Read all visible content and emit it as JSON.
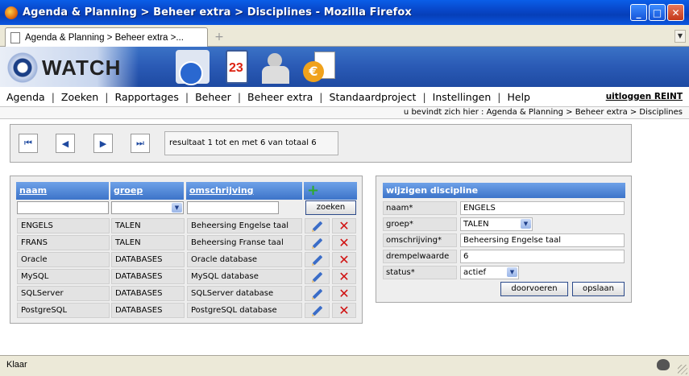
{
  "window": {
    "title": "Agenda & Planning > Beheer extra > Disciplines - Mozilla Firefox",
    "minimize": "_",
    "maximize": "□",
    "close": "✕"
  },
  "tabs": [
    {
      "label": "Agenda & Planning > Beheer extra >..."
    }
  ],
  "newtab": "+",
  "logo": {
    "text": "WATCH"
  },
  "calendar_day": "23",
  "euro": "€",
  "menu": {
    "items": [
      "Agenda",
      "Zoeken",
      "Rapportages",
      "Beheer",
      "Beheer extra",
      "Standaardproject",
      "Instellingen",
      "Help"
    ],
    "separator": "|",
    "logout": "uitloggen REINT"
  },
  "breadcrumb": "u bevindt zich hier : Agenda & Planning > Beheer extra > Disciplines",
  "pager": {
    "first": "⏮",
    "prev": "◀",
    "next": "▶",
    "last": "⏭",
    "info": "resultaat 1 tot en met 6 van totaal 6"
  },
  "table": {
    "headers": {
      "naam": "naam",
      "groep": "groep",
      "omschrijving": "omschrijving"
    },
    "add": "+",
    "search_button": "zoeken",
    "rows": [
      {
        "naam": "ENGELS",
        "groep": "TALEN",
        "omschrijving": "Beheersing Engelse taal"
      },
      {
        "naam": "FRANS",
        "groep": "TALEN",
        "omschrijving": "Beheersing Franse taal"
      },
      {
        "naam": "Oracle",
        "groep": "DATABASES",
        "omschrijving": "Oracle database"
      },
      {
        "naam": "MySQL",
        "groep": "DATABASES",
        "omschrijving": "MySQL database"
      },
      {
        "naam": "SQLServer",
        "groep": "DATABASES",
        "omschrijving": "SQLServer database"
      },
      {
        "naam": "PostgreSQL",
        "groep": "DATABASES",
        "omschrijving": "PostgreSQL database"
      }
    ]
  },
  "edit": {
    "title": "wijzigen discipline",
    "fields": {
      "naam": {
        "label": "naam*",
        "value": "ENGELS"
      },
      "groep": {
        "label": "groep*",
        "value": "TALEN"
      },
      "omschrijving": {
        "label": "omschrijving*",
        "value": "Beheersing Engelse taal"
      },
      "drempelwaarde": {
        "label": "drempelwaarde",
        "value": "6"
      },
      "status": {
        "label": "status*",
        "value": "actief"
      }
    },
    "apply": "doorvoeren",
    "save": "opslaan"
  },
  "status": {
    "text": "Klaar"
  }
}
